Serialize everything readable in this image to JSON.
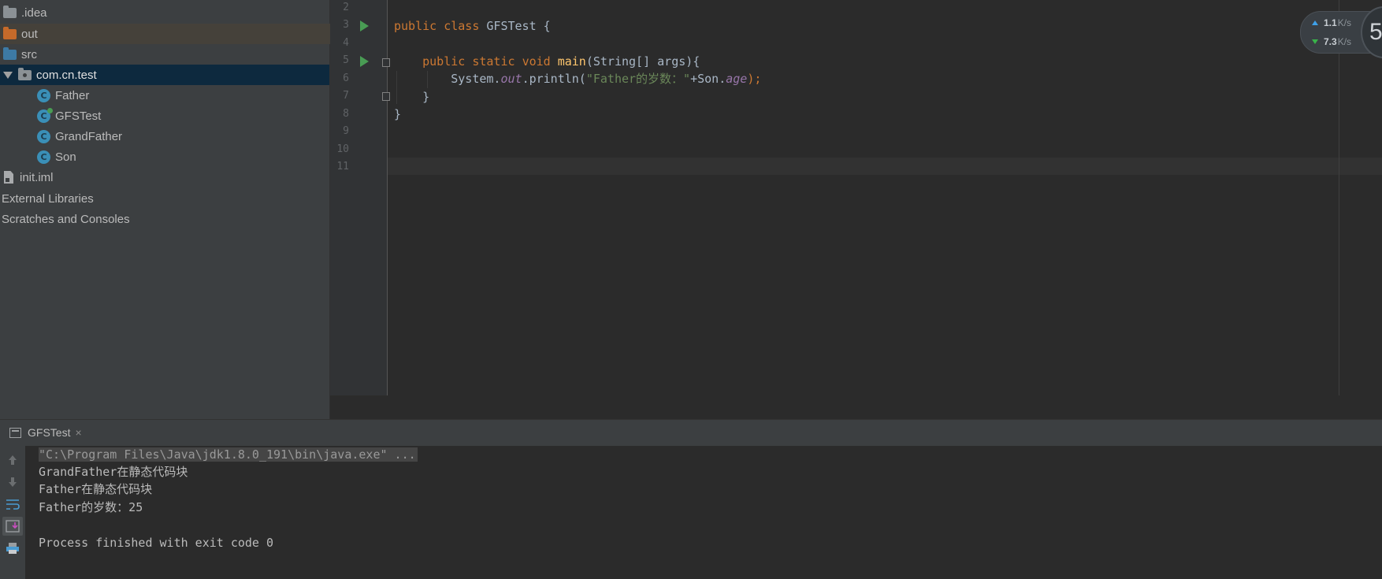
{
  "project_tree": {
    "items": [
      {
        "label": ".idea",
        "icon": "folder-icon"
      },
      {
        "label": "out",
        "icon": "folder-orange-icon"
      },
      {
        "label": "src",
        "icon": "folder-blue-icon"
      },
      {
        "label": "com.cn.test",
        "icon": "package-icon"
      },
      {
        "label": "Father",
        "icon": "class-icon"
      },
      {
        "label": "GFSTest",
        "icon": "class-runnable-icon"
      },
      {
        "label": "GrandFather",
        "icon": "class-icon"
      },
      {
        "label": "Son",
        "icon": "class-icon"
      },
      {
        "label": "init.iml",
        "icon": "file-icon"
      },
      {
        "label": "External Libraries"
      },
      {
        "label": "Scratches and Consoles"
      }
    ]
  },
  "editor": {
    "line_numbers": [
      "2",
      "3",
      "4",
      "5",
      "6",
      "7",
      "8",
      "9",
      "10",
      "11"
    ],
    "code": {
      "l3_kw1": "public",
      "l3_kw2": "class",
      "l3_name": " GFSTest {",
      "l5_kw1": "public",
      "l5_kw2": "static",
      "l5_kw3": "void",
      "l5_fn": "main",
      "l5_rest": "(String[] args){",
      "l6_a": "System.",
      "l6_out": "out",
      "l6_b": ".println(",
      "l6_str": "\"Father的岁数：\"",
      "l6_c": "+Son.",
      "l6_age": "age",
      "l6_d": ");",
      "l7": "}",
      "l8": "}"
    }
  },
  "net_widget": {
    "upload": "1.1",
    "download": "7.3",
    "unit": "K/s",
    "badge": "5"
  },
  "run_panel": {
    "tab_label": "GFSTest",
    "close_glyph": "×",
    "console_lines": [
      "\"C:\\Program Files\\Java\\jdk1.8.0_191\\bin\\java.exe\" ...",
      "GrandFather在静态代码块",
      "Father在静态代码块",
      "Father的岁数：25",
      "",
      "Process finished with exit code 0"
    ]
  },
  "colors": {
    "keyword": "#cc7832",
    "method": "#ffc66d",
    "string": "#6a8759",
    "static_field": "#9876aa",
    "run_green": "#499c54"
  }
}
